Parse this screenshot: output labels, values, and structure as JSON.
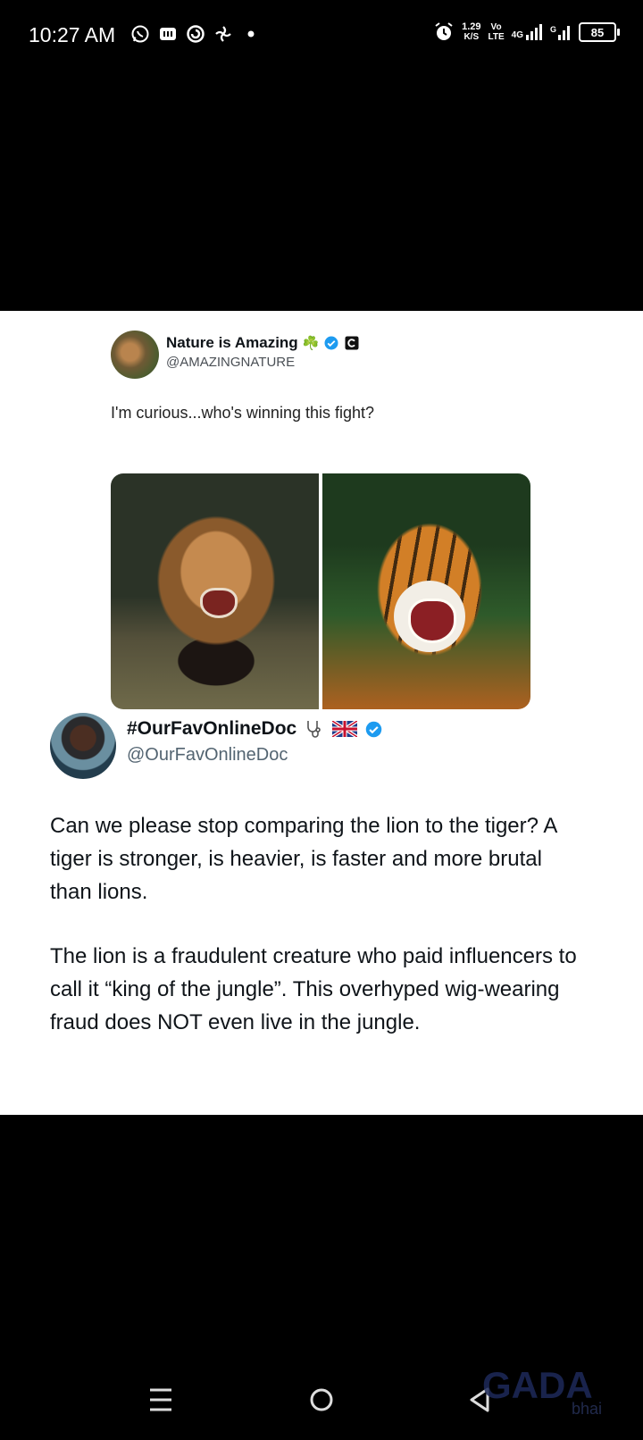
{
  "status_bar": {
    "time": "10:27 AM",
    "left_icons": [
      "whatsapp-icon",
      "app-icon",
      "app-icon",
      "settings-icon",
      "dot-icon"
    ],
    "net_speed_value": "1.29",
    "net_speed_unit": "K/S",
    "volte_top": "Vo",
    "volte_bottom": "LTE",
    "network": "4G",
    "battery": "85"
  },
  "quoted_tweet": {
    "author_name": "Nature is Amazing",
    "author_emoji": "☘️",
    "handle": "@AMAZINGNATURE",
    "text": "I'm curious...who's winning this fight?",
    "images": [
      "lion-photo",
      "tiger-photo"
    ]
  },
  "main_tweet": {
    "author_name": "#OurFavOnlineDoc",
    "handle": "@OurFavOnlineDoc",
    "paragraphs": [
      "Can we please stop comparing the lion to the tiger? A tiger is stronger, is heavier, is faster and more brutal than lions.",
      "The lion is a fraudulent creature who paid influencers to call it “king of the jungle”. This overhyped wig-wearing fraud does NOT even live in the jungle."
    ]
  },
  "colors": {
    "verified_blue": "#1d9bf0",
    "text_primary": "#0f1419",
    "text_secondary": "#536471"
  },
  "nav_bar": {
    "icons": [
      "menu-icon",
      "home-icon",
      "back-icon"
    ]
  }
}
